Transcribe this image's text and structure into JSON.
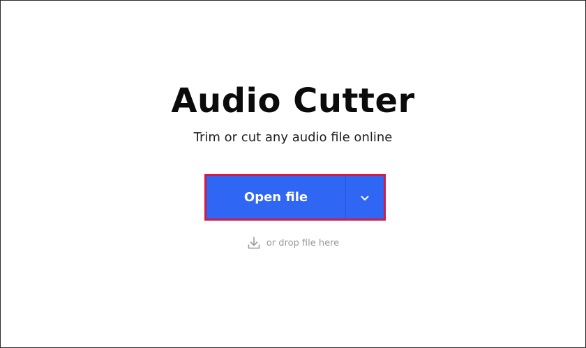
{
  "app": {
    "title": "Audio Cutter",
    "subtitle": "Trim or cut any audio file online"
  },
  "actions": {
    "open_file_label": "Open file",
    "dropdown_icon": "chevron-down-icon"
  },
  "drop_zone": {
    "hint_text": "or drop file here",
    "icon": "download-icon"
  },
  "colors": {
    "primary_button": "#2f66f4",
    "highlight_border": "#d41a45",
    "title_text": "#0b0b0b",
    "hint_text": "#9a9a9a"
  }
}
